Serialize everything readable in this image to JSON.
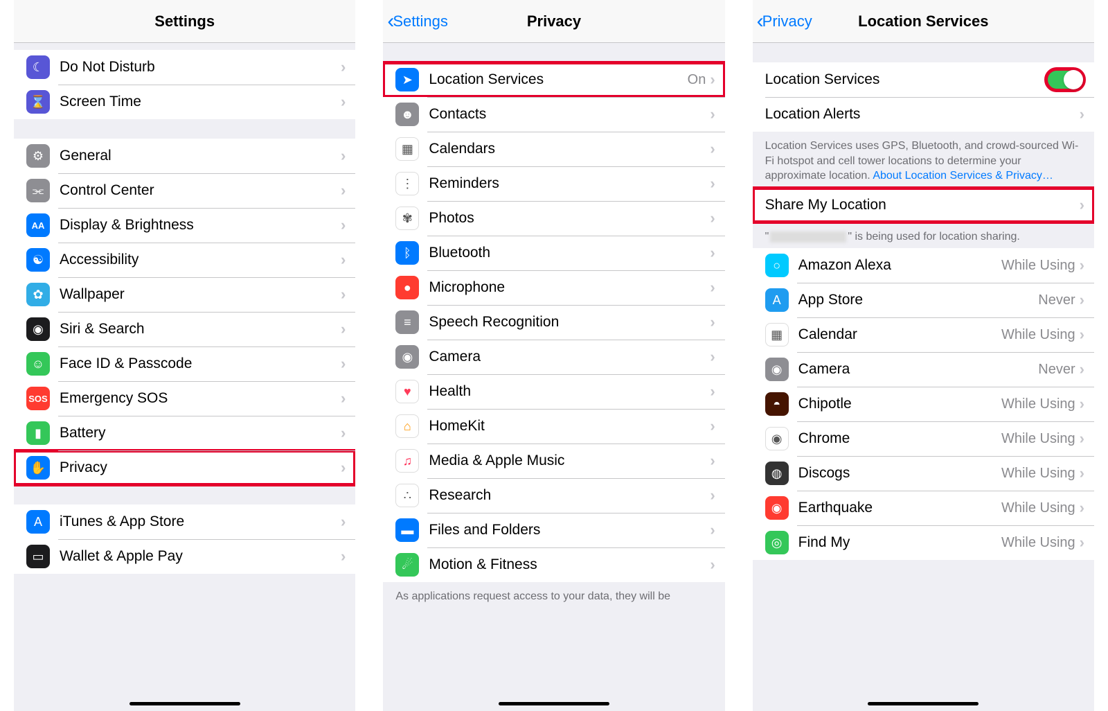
{
  "panel1": {
    "title": "Settings",
    "groups": [
      {
        "items": [
          {
            "icon": "moon",
            "bg": "#5856d6",
            "label": "Do Not Disturb"
          },
          {
            "icon": "hourglass",
            "bg": "#5856d6",
            "label": "Screen Time"
          }
        ]
      },
      {
        "items": [
          {
            "icon": "gear",
            "bg": "#8e8e93",
            "label": "General"
          },
          {
            "icon": "switches",
            "bg": "#8e8e93",
            "label": "Control Center"
          },
          {
            "icon": "AA",
            "bg": "#007aff",
            "label": "Display & Brightness"
          },
          {
            "icon": "person",
            "bg": "#007aff",
            "label": "Accessibility"
          },
          {
            "icon": "flower",
            "bg": "#31ade6",
            "label": "Wallpaper"
          },
          {
            "icon": "siri",
            "bg": "#1c1c1e",
            "label": "Siri & Search"
          },
          {
            "icon": "faceid",
            "bg": "#34c759",
            "label": "Face ID & Passcode"
          },
          {
            "icon": "SOS",
            "bg": "#ff3b30",
            "label": "Emergency SOS"
          },
          {
            "icon": "battery",
            "bg": "#34c759",
            "label": "Battery"
          },
          {
            "icon": "hand",
            "bg": "#007aff",
            "label": "Privacy",
            "hl": true
          }
        ]
      },
      {
        "items": [
          {
            "icon": "appstore",
            "bg": "#007aff",
            "label": "iTunes & App Store"
          },
          {
            "icon": "wallet",
            "bg": "#1c1c1e",
            "label": "Wallet & Apple Pay"
          }
        ]
      }
    ]
  },
  "panel2": {
    "back": "Settings",
    "title": "Privacy",
    "items": [
      {
        "icon": "location",
        "bg": "#007aff",
        "label": "Location Services",
        "detail": "On",
        "hl": true
      },
      {
        "icon": "contacts",
        "bg": "#8e8e93",
        "label": "Contacts"
      },
      {
        "icon": "calendar",
        "bg": "#fff",
        "label": "Calendars",
        "border": true
      },
      {
        "icon": "reminders",
        "bg": "#fff",
        "label": "Reminders",
        "border": true
      },
      {
        "icon": "photos",
        "bg": "#fff",
        "label": "Photos",
        "border": true
      },
      {
        "icon": "bluetooth",
        "bg": "#007aff",
        "label": "Bluetooth"
      },
      {
        "icon": "mic",
        "bg": "#ff3b30",
        "label": "Microphone"
      },
      {
        "icon": "speech",
        "bg": "#8e8e93",
        "label": "Speech Recognition"
      },
      {
        "icon": "camera",
        "bg": "#8e8e93",
        "label": "Camera"
      },
      {
        "icon": "health",
        "bg": "#fff",
        "label": "Health",
        "border": true
      },
      {
        "icon": "homekit",
        "bg": "#fff",
        "label": "HomeKit",
        "border": true
      },
      {
        "icon": "music",
        "bg": "#fff",
        "label": "Media & Apple Music",
        "border": true
      },
      {
        "icon": "research",
        "bg": "#fff",
        "label": "Research",
        "border": true
      },
      {
        "icon": "folder",
        "bg": "#007aff",
        "label": "Files and Folders"
      },
      {
        "icon": "motion",
        "bg": "#34c759",
        "label": "Motion & Fitness"
      }
    ],
    "footer": "As applications request access to your data, they will be"
  },
  "panel3": {
    "back": "Privacy",
    "title": "Location Services",
    "top": [
      {
        "label": "Location Services",
        "toggle": true,
        "hl_toggle": true
      },
      {
        "label": "Location Alerts",
        "chev": true
      }
    ],
    "footer1_a": "Location Services uses GPS, Bluetooth, and crowd-sourced Wi-Fi hotspot and cell tower locations to determine your approximate location. ",
    "footer1_link": "About Location Services & Privacy…",
    "share": {
      "label": "Share My Location",
      "hl": true
    },
    "footer2_a": "\"",
    "footer2_b": "\" is being used for location sharing.",
    "apps": [
      {
        "icon": "alexa",
        "bg": "#00caff",
        "label": "Amazon Alexa",
        "detail": "While Using"
      },
      {
        "icon": "appstore",
        "bg": "#1f9cf0",
        "label": "App Store",
        "detail": "Never"
      },
      {
        "icon": "calendar",
        "bg": "#fff",
        "label": "Calendar",
        "detail": "While Using",
        "border": true
      },
      {
        "icon": "camera",
        "bg": "#8e8e93",
        "label": "Camera",
        "detail": "Never"
      },
      {
        "icon": "chipotle",
        "bg": "#451400",
        "label": "Chipotle",
        "detail": "While Using"
      },
      {
        "icon": "chrome",
        "bg": "#fff",
        "label": "Chrome",
        "detail": "While Using",
        "border": true
      },
      {
        "icon": "discogs",
        "bg": "#333",
        "label": "Discogs",
        "detail": "While Using"
      },
      {
        "icon": "earthquake",
        "bg": "#ff3b30",
        "label": "Earthquake",
        "detail": "While Using"
      },
      {
        "icon": "findmy",
        "bg": "#34c759",
        "label": "Find My",
        "detail": "While Using"
      }
    ]
  }
}
